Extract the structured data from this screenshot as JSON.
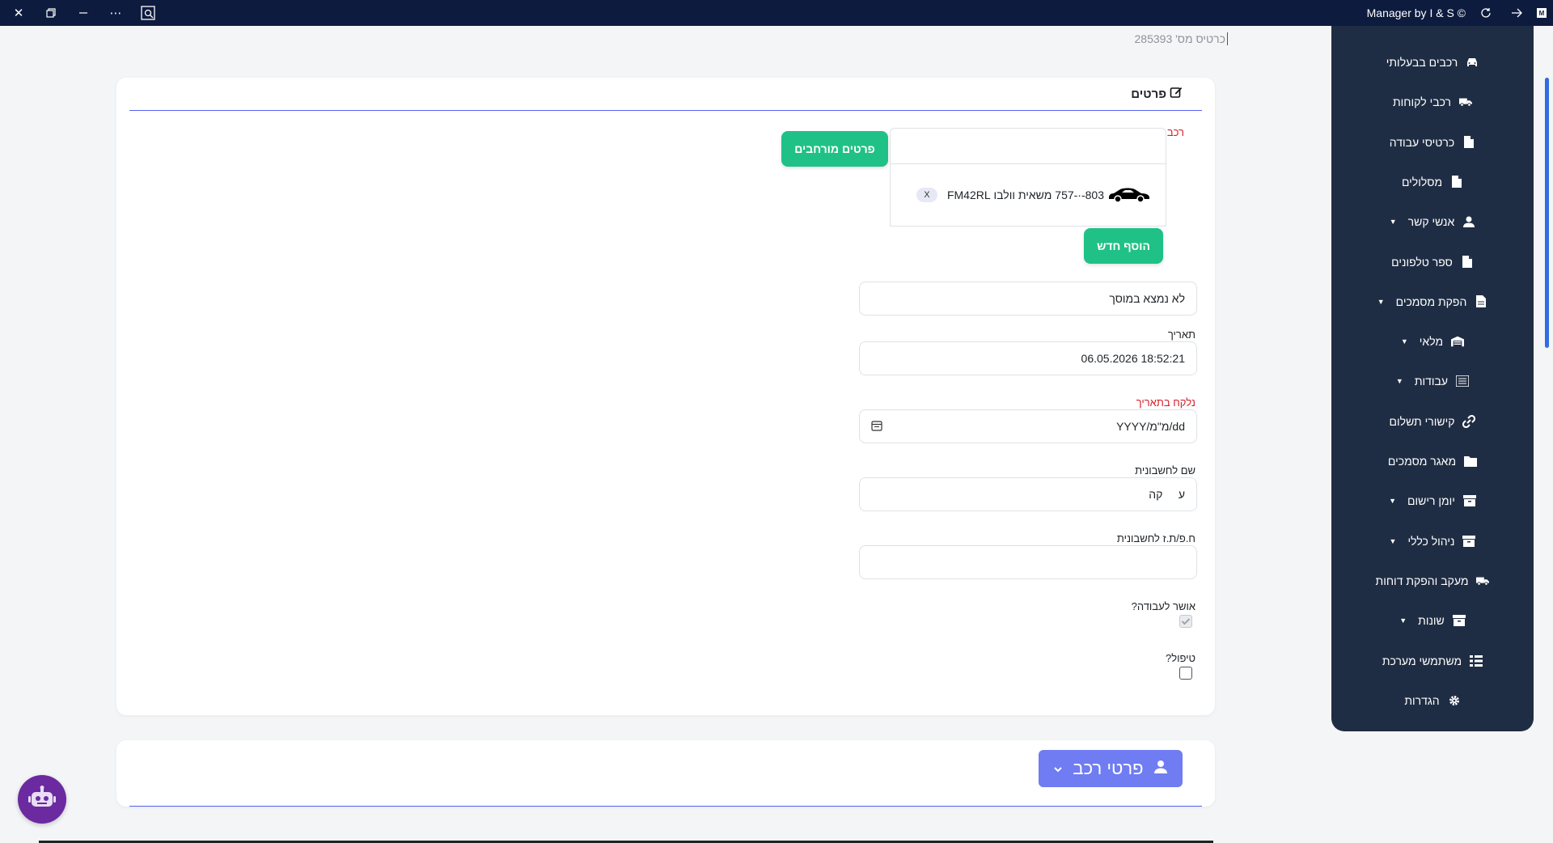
{
  "window": {
    "title": "Manager by I & S ©",
    "controls": [
      "close",
      "restore",
      "minimize",
      "more",
      "inspect"
    ]
  },
  "card_number": "כרטיס מס' 285393",
  "details": {
    "title": "פרטים",
    "vehicle_label": "רכב",
    "vehicle_search_value": "",
    "extended_details_button": "פרטים מורחבים",
    "selected_vehicle": "803-·-757 משאית וולבו FM42RL",
    "remove_chip": "X",
    "add_new_button": "הוסף חדש",
    "garage_status_value": "לא נמצא במוסך",
    "date_label": "תאריך",
    "date_value": "18:52:21 06.05.2026",
    "taken_on_label": "נלקח בתאריך",
    "taken_on_placeholder": "dd/מ\"מ/YYYY",
    "invoice_name_label": "שם לחשבונית",
    "invoice_name_value": "ע     קה",
    "invoice_id_label": "ח.פ/ת.ז לחשבונית",
    "invoice_id_value": "",
    "approved_label": "אושר לעבודה?",
    "approved_checked": true,
    "treatment_label": "טיפול?",
    "treatment_checked": false
  },
  "vehicle_details": {
    "button_label": "פרטי רכב"
  },
  "sidebar": {
    "items": [
      {
        "label": "רכבים בבעלותי",
        "icon": "car-icon",
        "caret": false
      },
      {
        "label": "רכבי לקוחות",
        "icon": "truck-icon",
        "caret": false
      },
      {
        "label": "כרטיסי עבודה",
        "icon": "file-icon",
        "caret": false
      },
      {
        "label": "מסלולים",
        "icon": "file-icon",
        "caret": false
      },
      {
        "label": "אנשי קשר",
        "icon": "user-icon",
        "caret": true
      },
      {
        "label": "ספר טלפונים",
        "icon": "file-icon",
        "caret": false
      },
      {
        "label": "הפקת מסמכים",
        "icon": "file-text-icon",
        "caret": true
      },
      {
        "label": "מלאי",
        "icon": "warehouse-icon",
        "caret": true
      },
      {
        "label": "עבודות",
        "icon": "list-icon",
        "caret": true
      },
      {
        "label": "קישורי תשלום",
        "icon": "link-icon",
        "caret": false
      },
      {
        "label": "מאגר מסמכים",
        "icon": "folder-icon",
        "caret": false
      },
      {
        "label": "יומן רישום",
        "icon": "archive-icon",
        "caret": true
      },
      {
        "label": "ניהול כללי",
        "icon": "archive-icon",
        "caret": true
      },
      {
        "label": "מעקב והפקת דוחות",
        "icon": "truck-icon",
        "caret": false
      },
      {
        "label": "שונות",
        "icon": "archive-icon",
        "caret": true
      },
      {
        "label": "משתמשי מערכת",
        "icon": "users-list-icon",
        "caret": false
      },
      {
        "label": "הגדרות",
        "icon": "gear-icon",
        "caret": false
      }
    ]
  }
}
